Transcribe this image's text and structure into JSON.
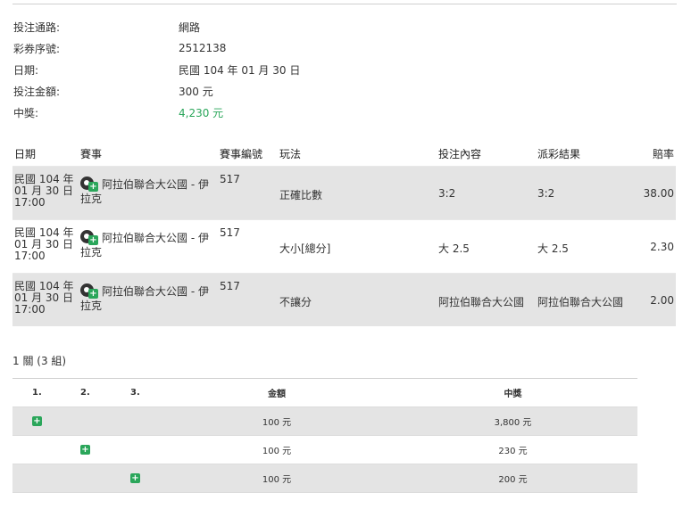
{
  "summary": {
    "channel_label": "投注通路:",
    "channel_value": "網路",
    "serial_label": "彩券序號:",
    "serial_value": "2512138",
    "date_label": "日期:",
    "date_value": "民國 104 年 01 月 30 日",
    "stake_label": "投注金額:",
    "stake_value": "300 元",
    "win_label": "中獎:",
    "win_value": "4,230 元"
  },
  "bets": {
    "headers": {
      "date": "日期",
      "event": "賽事",
      "event_no": "賽事編號",
      "play": "玩法",
      "pick": "投注內容",
      "result": "派彩結果",
      "odds": "賠率"
    },
    "rows": [
      {
        "date1": "民國 104 年",
        "date2": "01 月 30 日",
        "time": "17:00",
        "event1": "阿拉伯聯合大公國 - 伊",
        "event2": "拉克",
        "no": "517",
        "play": "正確比數",
        "pick": "3:2",
        "result": "3:2",
        "odds": "38.00"
      },
      {
        "date1": "民國 104 年",
        "date2": "01 月 30 日",
        "time": "17:00",
        "event1": "阿拉伯聯合大公國 - 伊",
        "event2": "拉克",
        "no": "517",
        "play": "大小[總分]",
        "pick": "大 2.5",
        "result": "大 2.5",
        "odds": "2.30"
      },
      {
        "date1": "民國 104 年",
        "date2": "01 月 30 日",
        "time": "17:00",
        "event1": "阿拉伯聯合大公國 - 伊",
        "event2": "拉克",
        "no": "517",
        "play": "不讓分",
        "pick": "阿拉伯聯合大公國",
        "result": "阿拉伯聯合大公國",
        "odds": "2.00"
      }
    ]
  },
  "combo_label": "1 關 (3 組)",
  "combo": {
    "headers": {
      "c1": "1.",
      "c2": "2.",
      "c3": "3.",
      "amount": "金額",
      "win": "中獎"
    },
    "rows": [
      {
        "amount": "100 元",
        "win": "3,800 元"
      },
      {
        "amount": "100 元",
        "win": "230 元"
      },
      {
        "amount": "100 元",
        "win": "200 元"
      }
    ]
  },
  "icons": {
    "event": "soccer-ball-plus-icon",
    "selected": "green-plus-square-icon"
  },
  "colors": {
    "win": "#2aa65a",
    "shade": "#e4e4e4"
  }
}
